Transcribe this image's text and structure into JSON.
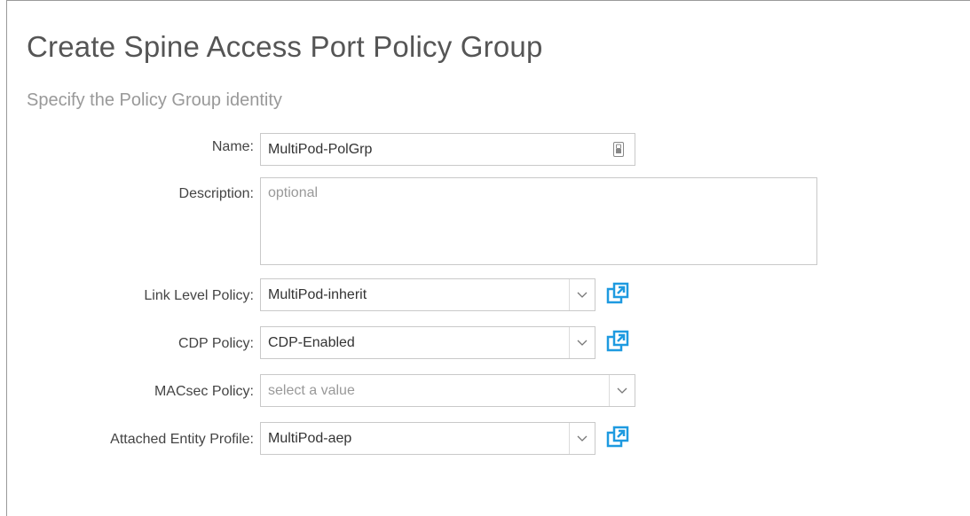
{
  "form": {
    "title": "Create Spine Access Port Policy Group",
    "subtitle": "Specify the Policy Group identity",
    "name": {
      "label": "Name:",
      "value": "MultiPod-PolGrp",
      "icon": "password-key-icon"
    },
    "description": {
      "label": "Description:",
      "placeholder": "optional"
    },
    "link_level_policy": {
      "label": "Link Level Policy:",
      "value": "MultiPod-inherit",
      "icon": "open-external-icon"
    },
    "cdp_policy": {
      "label": "CDP Policy:",
      "value": "CDP-Enabled",
      "icon": "open-external-icon"
    },
    "macsec_policy": {
      "label": "MACsec Policy:",
      "placeholder": "select a value"
    },
    "attached_entity_profile": {
      "label": "Attached Entity Profile:",
      "value": "MultiPod-aep",
      "icon": "open-external-icon"
    }
  },
  "colors": {
    "accent": "#1e9ae0",
    "border": "#c9c9c9",
    "frame": "#9a9a9a"
  }
}
